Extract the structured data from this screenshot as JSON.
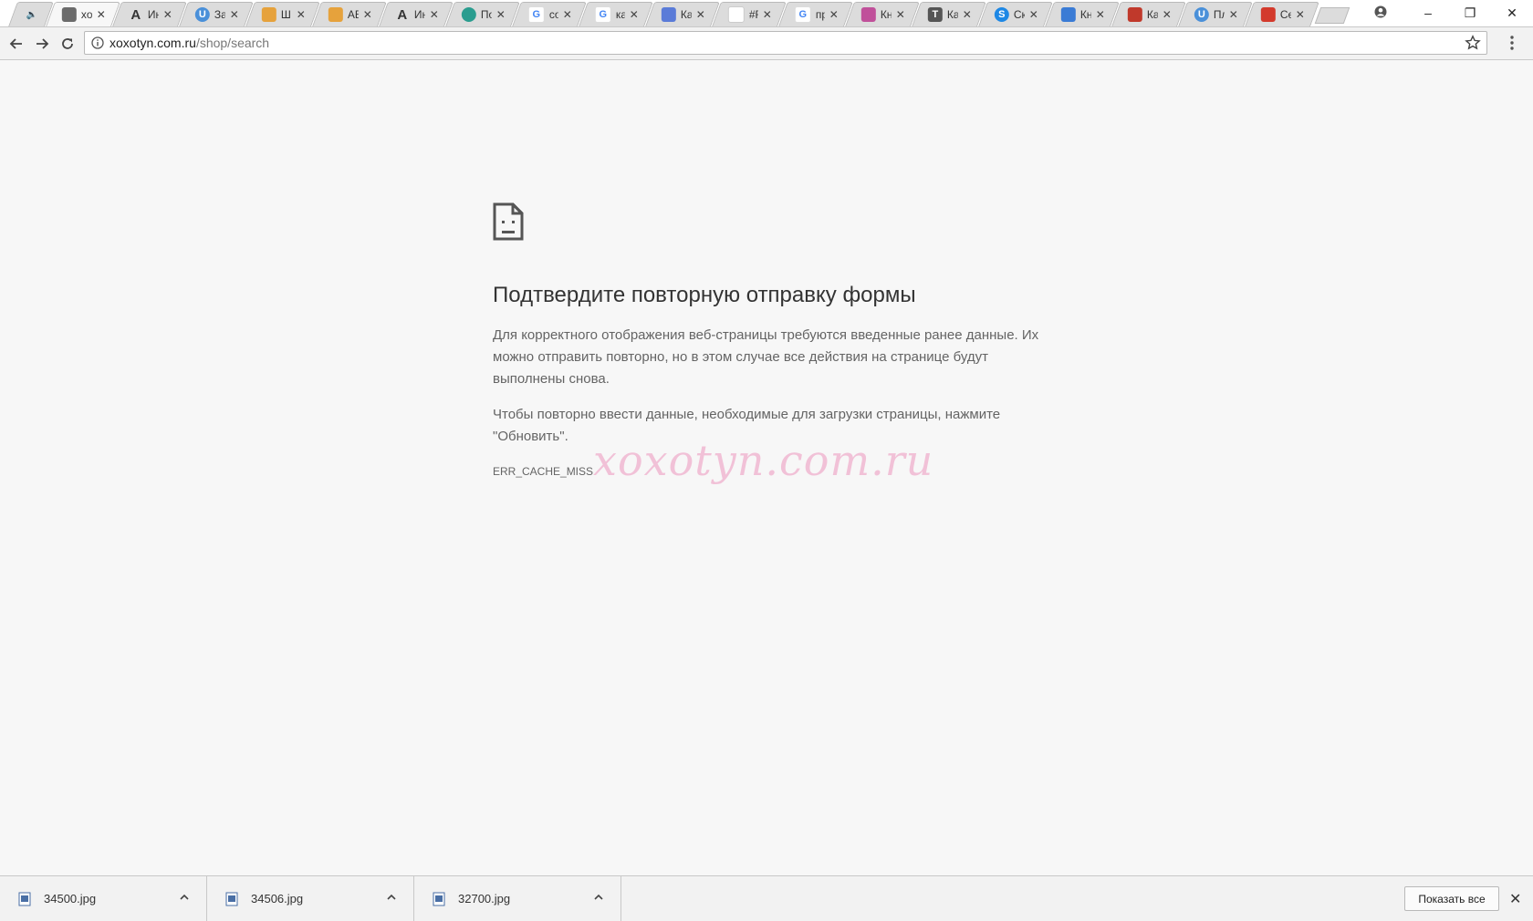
{
  "browser": {
    "tabs": [
      {
        "title": "",
        "favicon": "speaker-icon",
        "pinned": true,
        "color": "#dcdcdc"
      },
      {
        "title": "xo",
        "favicon": "page-icon",
        "active": true,
        "color": "#6b6b6b"
      },
      {
        "title": "Ин",
        "favicon": "A",
        "color": "#333333"
      },
      {
        "title": "За",
        "favicon": "U",
        "color": "#4a90d9"
      },
      {
        "title": "Ш",
        "favicon": "squares",
        "color": "#e6a23c"
      },
      {
        "title": "АБ",
        "favicon": "squares",
        "color": "#e6a23c"
      },
      {
        "title": "Ин",
        "favicon": "A",
        "color": "#333333"
      },
      {
        "title": "По",
        "favicon": "circle",
        "color": "#2a9d8f"
      },
      {
        "title": "co",
        "favicon": "G",
        "color": "#4285f4"
      },
      {
        "title": "ка",
        "favicon": "G",
        "color": "#4285f4"
      },
      {
        "title": "Ка",
        "favicon": "diamond",
        "color": "#5a7bd8"
      },
      {
        "title": "#F",
        "favicon": "blank",
        "color": "#ffffff"
      },
      {
        "title": "пр",
        "favicon": "G",
        "color": "#4285f4"
      },
      {
        "title": "Кн",
        "favicon": "flower",
        "color": "#c0509a"
      },
      {
        "title": "Ка",
        "favicon": "T",
        "color": "#555555"
      },
      {
        "title": "Ск",
        "favicon": "S",
        "color": "#1e88e5"
      },
      {
        "title": "Кн",
        "favicon": "pen",
        "color": "#3a7bd5"
      },
      {
        "title": "Ка",
        "favicon": "shield",
        "color": "#c0392b"
      },
      {
        "title": "Пл",
        "favicon": "U",
        "color": "#4a90d9"
      },
      {
        "title": "Се",
        "favicon": "tower",
        "color": "#d33a2c"
      }
    ],
    "url_host": "xoxotyn.com.ru",
    "url_path": "/shop/search"
  },
  "error_page": {
    "title": "Подтвердите повторную отправку формы",
    "paragraph1": "Для корректного отображения веб-страницы требуются введенные ранее данные. Их можно отправить повторно, но в этом случае все действия на странице будут выполнены снова.",
    "paragraph2": "Чтобы повторно ввести данные, необходимые для загрузки страницы, нажмите \"Обновить\".",
    "error_code": "ERR_CACHE_MISS",
    "watermark": "xoxotyn.com.ru"
  },
  "downloads": {
    "items": [
      {
        "name": "34500.jpg"
      },
      {
        "name": "34506.jpg"
      },
      {
        "name": "32700.jpg"
      }
    ],
    "show_all_label": "Показать все"
  }
}
